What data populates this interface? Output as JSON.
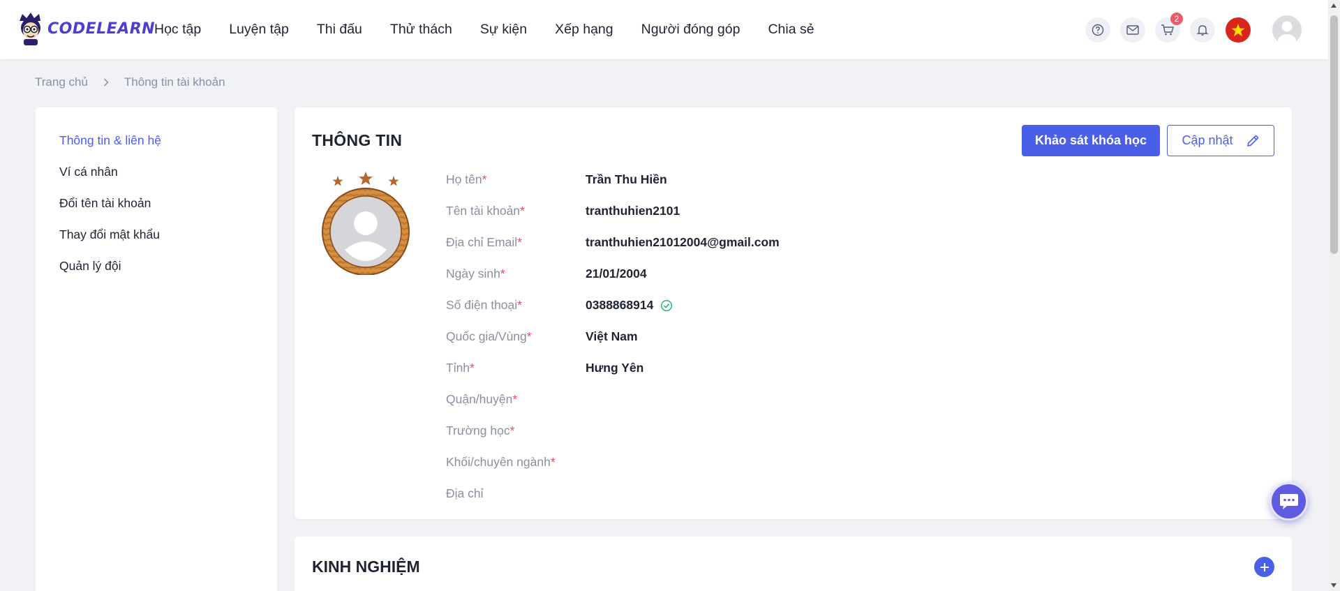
{
  "brand": {
    "name": "CODELEARN"
  },
  "nav": {
    "items": [
      "Học tập",
      "Luyện tập",
      "Thi đấu",
      "Thử thách",
      "Sự kiện",
      "Xếp hạng",
      "Người đóng góp",
      "Chia sẻ"
    ]
  },
  "header_icons": {
    "help": "help-icon",
    "mail": "mail-icon",
    "cart": "cart-icon",
    "cart_badge": "2",
    "bell": "bell-icon",
    "language_flag": "vietnam-flag-icon"
  },
  "breadcrumb": {
    "home": "Trang chủ",
    "current": "Thông tin tài khoản"
  },
  "sidebar": {
    "items": [
      {
        "label": "Thông tin & liên hệ",
        "active": true
      },
      {
        "label": "Ví cá nhân"
      },
      {
        "label": "Đổi tên tài khoản"
      },
      {
        "label": "Thay đổi mật khẩu"
      },
      {
        "label": "Quản lý đội"
      }
    ]
  },
  "info": {
    "title": "THÔNG TIN",
    "survey_button": "Khảo sát khóa học",
    "update_button": "Cập nhật",
    "fields": [
      {
        "label": "Họ tên",
        "required": "*",
        "value": "Trần Thu Hiền"
      },
      {
        "label": "Tên tài khoản",
        "required": "*",
        "value": "tranthuhien2101"
      },
      {
        "label": "Địa chỉ Email",
        "required": "*",
        "value": "tranthuhien21012004@gmail.com"
      },
      {
        "label": "Ngày sinh",
        "required": "*",
        "value": "21/01/2004"
      },
      {
        "label": "Số điện thoại",
        "required": "*",
        "value": "0388868914"
      },
      {
        "label": "Quốc gia/Vùng",
        "required": "*",
        "value": "Việt Nam"
      },
      {
        "label": "Tỉnh",
        "required": "*",
        "value": "Hưng Yên"
      },
      {
        "label": "Quận/huyện",
        "required": "*",
        "value": ""
      },
      {
        "label": "Trường học",
        "required": "*",
        "value": ""
      },
      {
        "label": "Khối/chuyên ngành",
        "required": "*",
        "value": ""
      },
      {
        "label": "Địa chỉ",
        "required": "",
        "value": ""
      }
    ]
  },
  "experience": {
    "title": "KINH NGHIỆM"
  },
  "colors": {
    "accent": "#4a5fe8",
    "required": "#e84a5f",
    "verified": "#2bb673",
    "frame": "#c9772e"
  }
}
